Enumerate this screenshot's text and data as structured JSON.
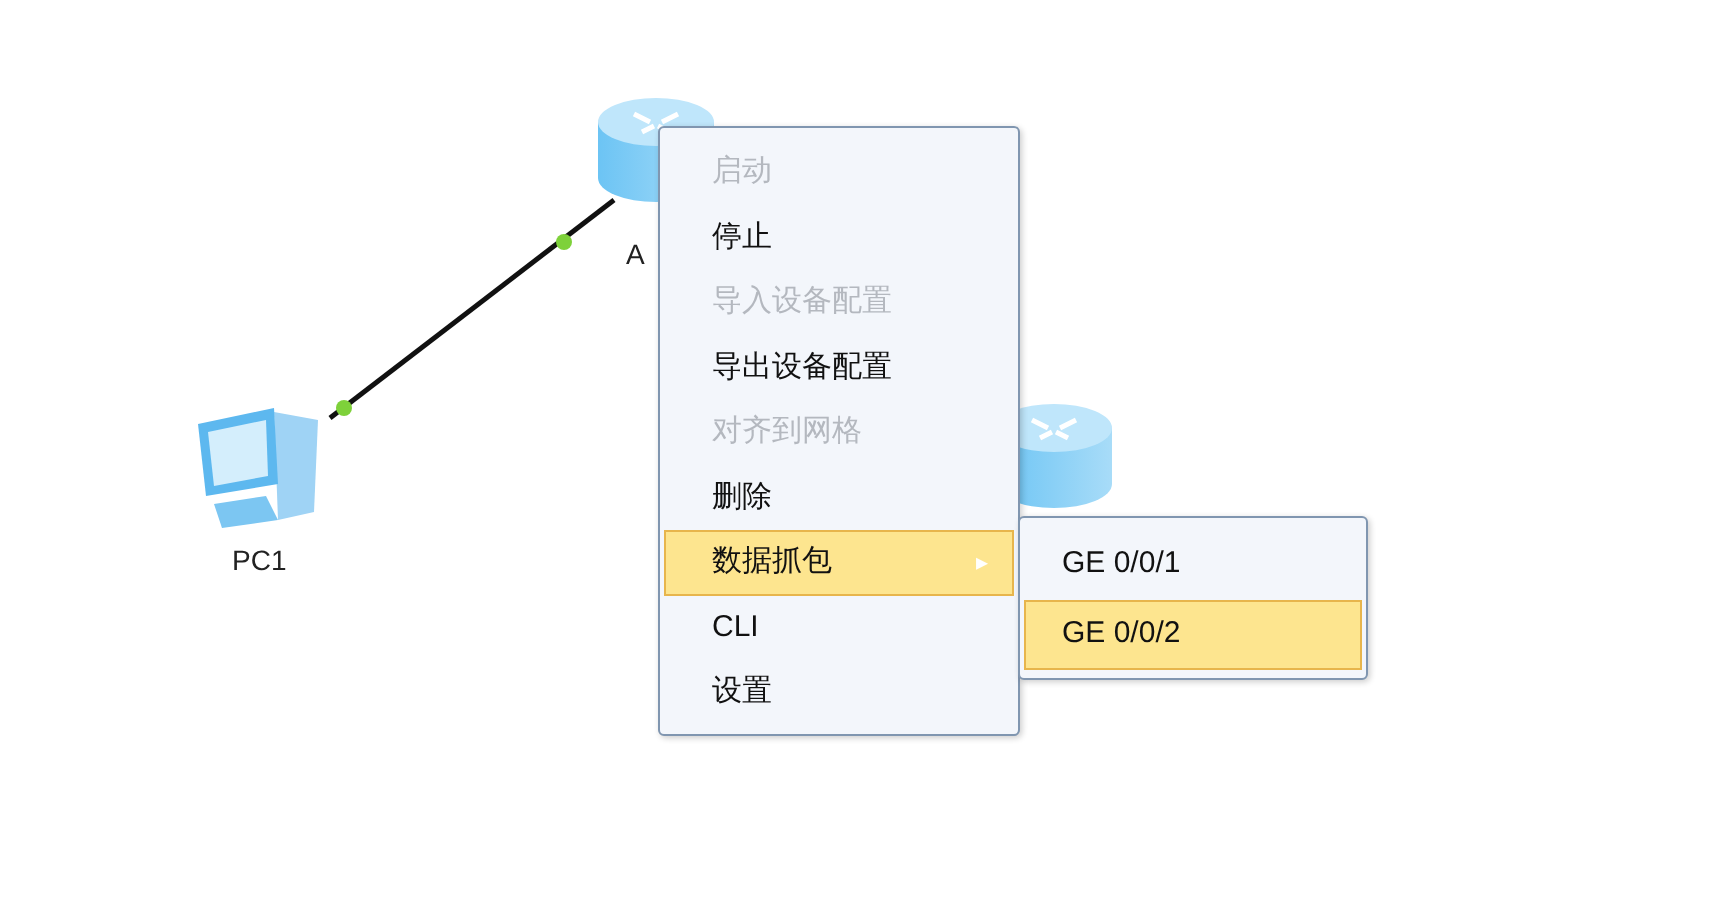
{
  "topology": {
    "devices": [
      {
        "kind": "router",
        "label": "A"
      },
      {
        "kind": "pc",
        "label": "PC1"
      },
      {
        "kind": "router"
      }
    ]
  },
  "context_menu": {
    "items": [
      {
        "label": "启动",
        "disabled": true,
        "selected": false
      },
      {
        "label": "停止",
        "disabled": false,
        "selected": false
      },
      {
        "label": "导入设备配置",
        "disabled": true,
        "selected": false
      },
      {
        "label": "导出设备配置",
        "disabled": false,
        "selected": false
      },
      {
        "label": "对齐到网格",
        "disabled": true,
        "selected": false
      },
      {
        "label": "删除",
        "disabled": false,
        "selected": false
      },
      {
        "label": "数据抓包",
        "disabled": false,
        "selected": true,
        "submenu_arrow": "▸"
      },
      {
        "label": "CLI",
        "disabled": false,
        "selected": false
      },
      {
        "label": "设置",
        "disabled": false,
        "selected": false
      }
    ]
  },
  "submenu": {
    "items": [
      {
        "label": "GE 0/0/1",
        "selected": false
      },
      {
        "label": "GE 0/0/2",
        "selected": true
      }
    ]
  }
}
